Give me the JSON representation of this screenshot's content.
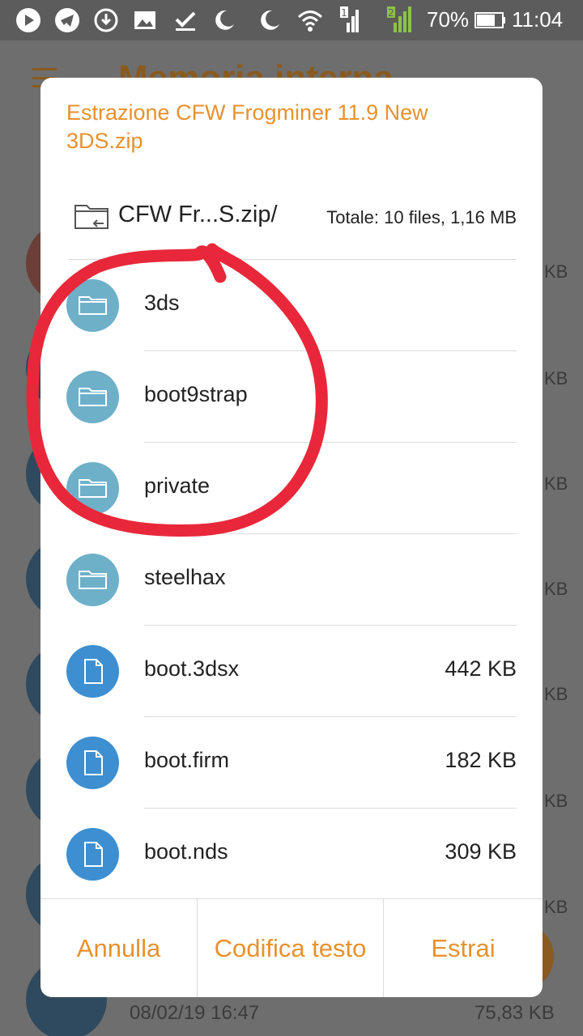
{
  "status_bar": {
    "battery_text": "70%",
    "time": "11:04",
    "icons": [
      "play-icon",
      "telegram-icon",
      "download-icon",
      "image-icon",
      "check-icon",
      "moon-icon",
      "moon-icon",
      "wifi-icon",
      "signal-sim1-icon",
      "signal-sim2-icon",
      "battery-icon"
    ]
  },
  "background_app": {
    "title": "Memoria interna",
    "last_item_date": "08/02/19 16:47",
    "last_item_size": "75,83 KB",
    "partial_sizes": [
      "KB",
      "KB",
      "KB",
      "KB",
      "KB",
      "KB",
      "KB",
      "KB"
    ]
  },
  "dialog": {
    "title": "Estrazione CFW Frogminer 11.9 New 3DS.zip",
    "path": "CFW Fr...S.zip/",
    "total": "Totale: 10 files, 1,16 MB",
    "items": [
      {
        "name": "3ds",
        "type": "folder",
        "size": ""
      },
      {
        "name": "boot9strap",
        "type": "folder",
        "size": ""
      },
      {
        "name": "private",
        "type": "folder",
        "size": ""
      },
      {
        "name": "steelhax",
        "type": "folder",
        "size": ""
      },
      {
        "name": "boot.3dsx",
        "type": "file",
        "size": "442 KB"
      },
      {
        "name": "boot.firm",
        "type": "file",
        "size": "182 KB"
      },
      {
        "name": "boot.nds",
        "type": "file",
        "size": "309 KB"
      }
    ],
    "buttons": {
      "cancel": "Annulla",
      "encode": "Codifica testo",
      "extract": "Estrai"
    }
  },
  "colors": {
    "accent": "#e8912d",
    "folder_icon": "#6fb0c9",
    "file_icon": "#3d8fd1",
    "annotation": "#e8283a"
  }
}
